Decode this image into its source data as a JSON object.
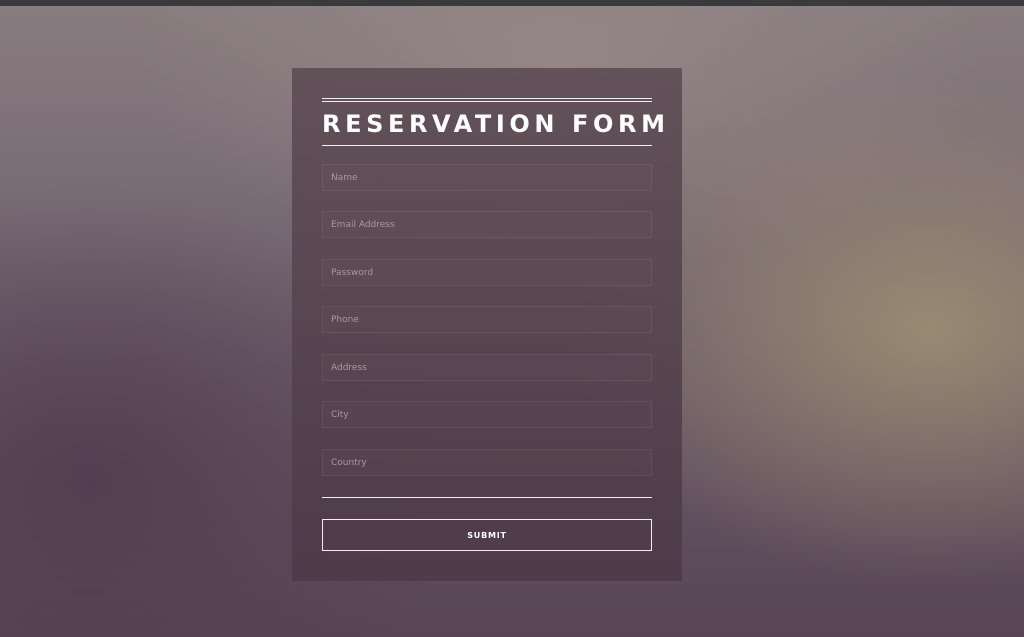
{
  "form": {
    "title": "RESERVATION FORM",
    "fields": [
      {
        "name": "name",
        "placeholder": "Name",
        "value": ""
      },
      {
        "name": "email",
        "placeholder": "Email Address",
        "value": ""
      },
      {
        "name": "password",
        "placeholder": "Password",
        "value": ""
      },
      {
        "name": "phone",
        "placeholder": "Phone",
        "value": ""
      },
      {
        "name": "address",
        "placeholder": "Address",
        "value": ""
      },
      {
        "name": "city",
        "placeholder": "City",
        "value": ""
      },
      {
        "name": "country",
        "placeholder": "Country",
        "value": ""
      }
    ],
    "submit_label": "SUBMIT"
  },
  "colors": {
    "panel": "#5a4752",
    "text": "#ffffff",
    "placeholder": "#a8999f",
    "rule": "#f2eef0"
  }
}
